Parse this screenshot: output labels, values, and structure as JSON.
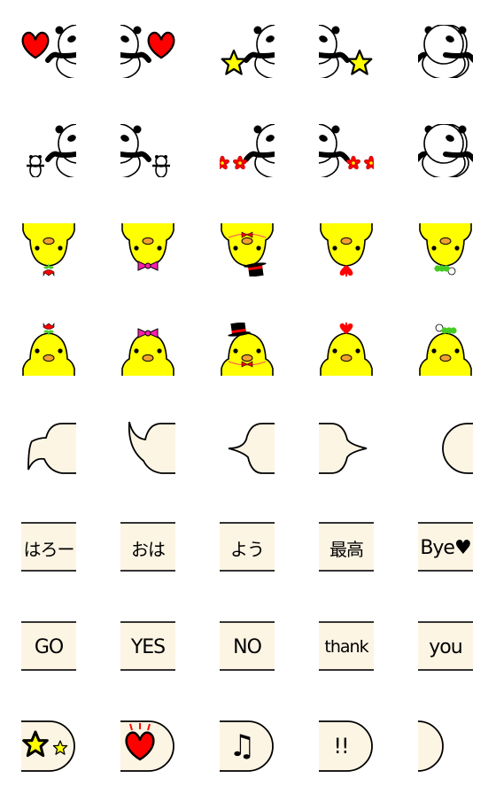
{
  "colors": {
    "cream": "#fdf5e4",
    "yellow": "#ffff00",
    "red": "#ff0000",
    "pink": "#ff1fae",
    "green": "#44cc22",
    "orange": "#f0a030",
    "black": "#000000"
  },
  "grid": [
    [
      {
        "icon": "panda-right-heart"
      },
      {
        "icon": "panda-left-heart"
      },
      {
        "icon": "panda-right-star"
      },
      {
        "icon": "panda-left-star"
      },
      {
        "icon": "panda-full"
      }
    ],
    [
      {
        "icon": "panda-right-baby"
      },
      {
        "icon": "panda-left-baby"
      },
      {
        "icon": "panda-right-flowers"
      },
      {
        "icon": "panda-left-flowers"
      },
      {
        "icon": "panda-pair"
      }
    ],
    [
      {
        "icon": "chick-down-tulip"
      },
      {
        "icon": "chick-down-bow"
      },
      {
        "icon": "chick-down-hat"
      },
      {
        "icon": "chick-down-heart"
      },
      {
        "icon": "chick-down-caterpillar"
      }
    ],
    [
      {
        "icon": "chick-up-tulip"
      },
      {
        "icon": "chick-up-bow"
      },
      {
        "icon": "chick-up-hat"
      },
      {
        "icon": "chick-up-heart"
      },
      {
        "icon": "chick-up-caterpillar"
      }
    ],
    [
      {
        "icon": "bubble-tail-down"
      },
      {
        "icon": "bubble-tail-up"
      },
      {
        "icon": "bubble-tail-left"
      },
      {
        "icon": "bubble-tail-right"
      },
      {
        "icon": "bubble-half"
      }
    ],
    [
      {
        "icon": "text-box",
        "text": "はろー"
      },
      {
        "icon": "text-box",
        "text": "おは"
      },
      {
        "icon": "text-box",
        "text": "よう"
      },
      {
        "icon": "text-box",
        "text": "最高"
      },
      {
        "icon": "text-box",
        "text": "Bye♥"
      }
    ],
    [
      {
        "icon": "text-box",
        "text": "GO"
      },
      {
        "icon": "text-box",
        "text": "YES"
      },
      {
        "icon": "text-box",
        "text": "NO"
      },
      {
        "icon": "text-box",
        "text": "thank"
      },
      {
        "icon": "text-box",
        "text": "you"
      }
    ],
    [
      {
        "icon": "pill-stars"
      },
      {
        "icon": "pill-heart"
      },
      {
        "icon": "pill-music-note",
        "text": "♫"
      },
      {
        "icon": "pill-exclamation",
        "text": "!!"
      },
      {
        "icon": "pill-empty"
      }
    ]
  ]
}
